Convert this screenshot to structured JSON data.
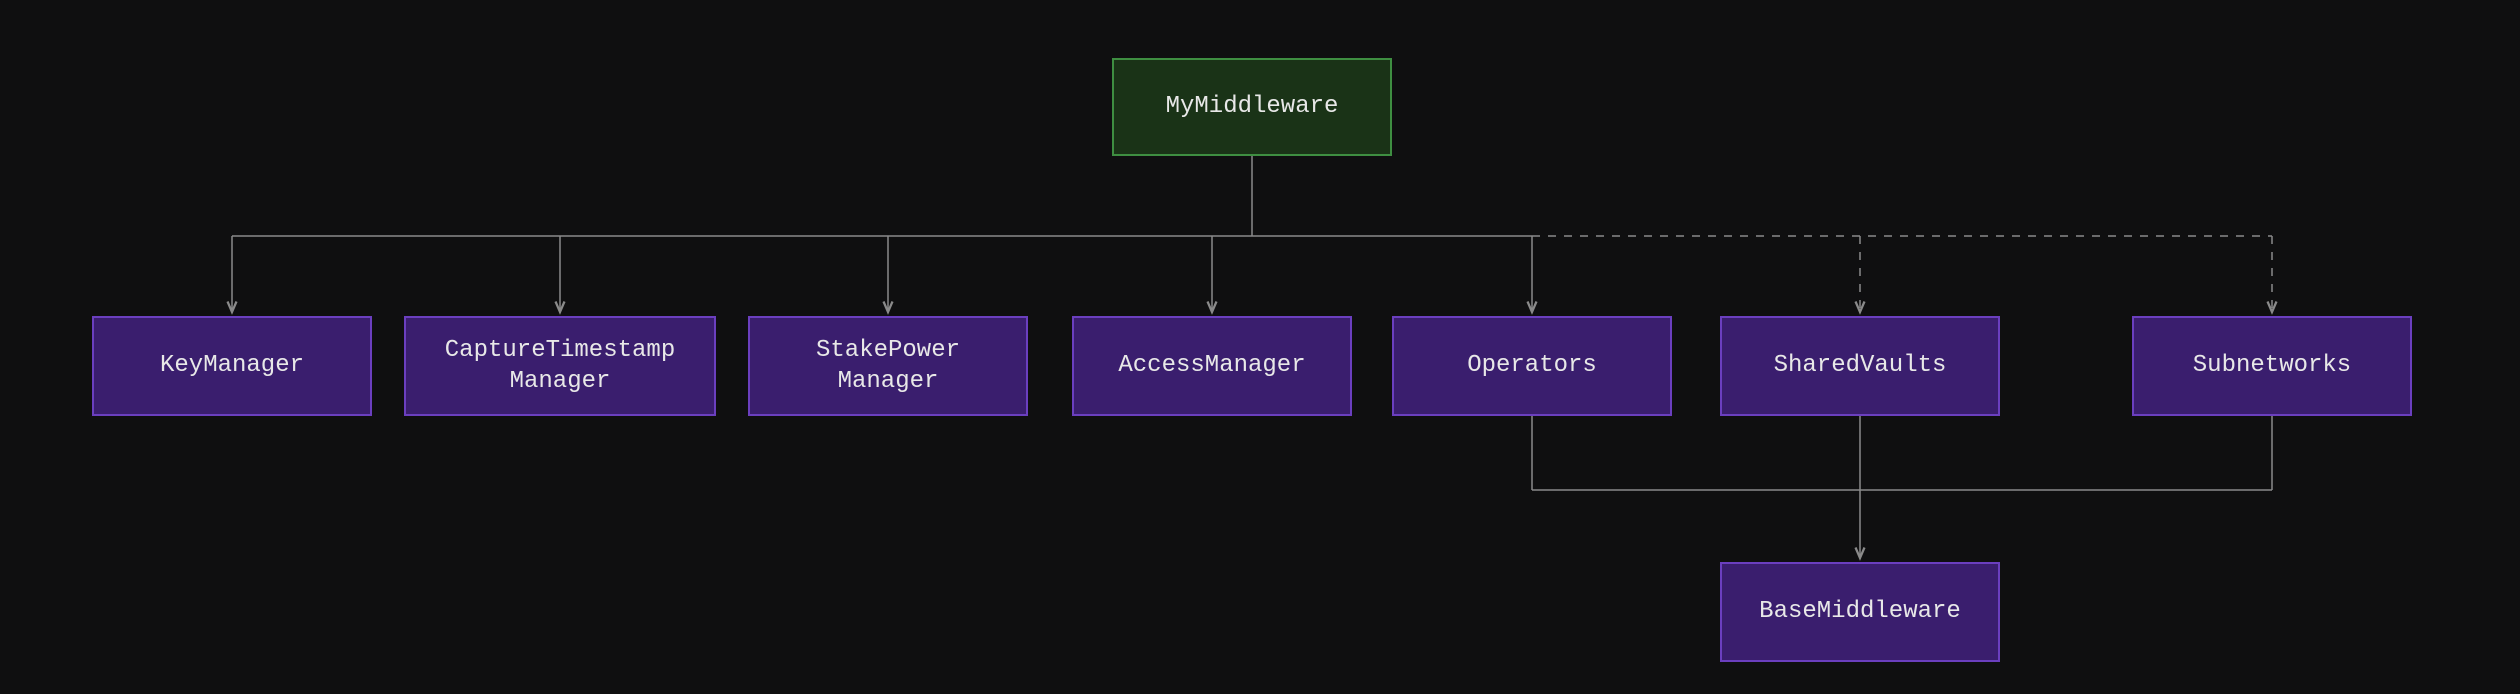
{
  "diagram": {
    "root": {
      "label": "MyMiddleware"
    },
    "tier2": [
      {
        "id": "key-manager",
        "label": "KeyManager"
      },
      {
        "id": "capture-timestamp-manager",
        "label": "CaptureTimestamp\nManager"
      },
      {
        "id": "stake-power-manager",
        "label": "StakePower\nManager"
      },
      {
        "id": "access-manager",
        "label": "AccessManager"
      },
      {
        "id": "operators",
        "label": "Operators"
      },
      {
        "id": "shared-vaults",
        "label": "SharedVaults"
      },
      {
        "id": "subnetworks",
        "label": "Subnetworks"
      }
    ],
    "tier3": {
      "label": "BaseMiddleware"
    },
    "edges": {
      "solid_from_root": [
        "key-manager",
        "capture-timestamp-manager",
        "stake-power-manager",
        "access-manager",
        "operators"
      ],
      "dashed_from_root": [
        "shared-vaults",
        "subnetworks"
      ],
      "solid_to_base": [
        "operators",
        "shared-vaults",
        "subnetworks"
      ]
    },
    "colors": {
      "bg": "#0f0f10",
      "green_fill": "#1a3317",
      "green_border": "#3e8e41",
      "purple_fill": "#3a1e6e",
      "purple_border": "#6b3fbf",
      "line": "#8a8a8a"
    }
  }
}
